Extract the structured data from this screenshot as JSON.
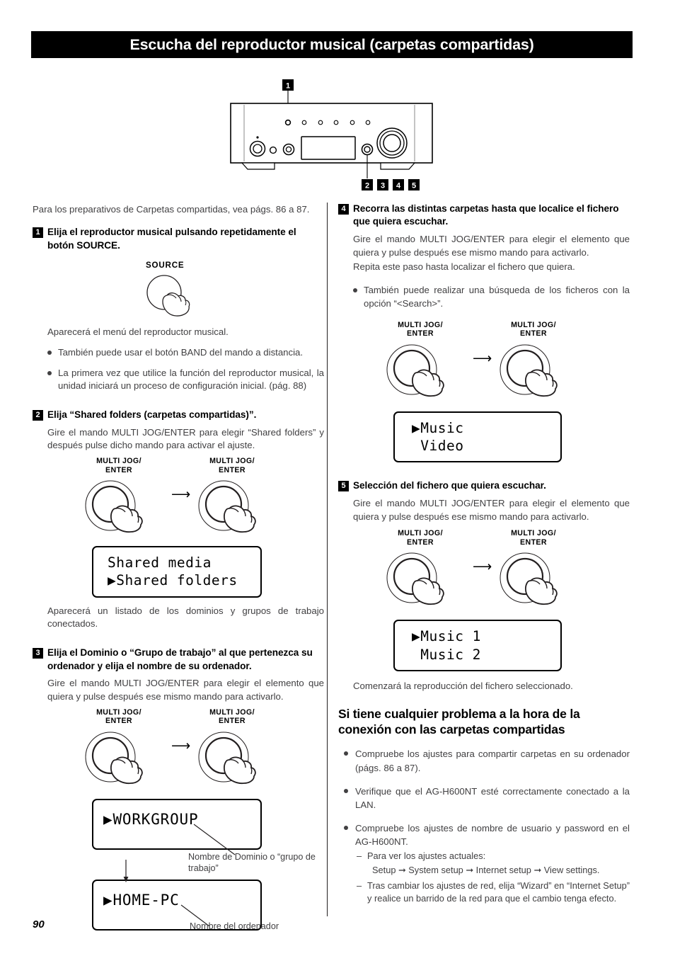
{
  "page": {
    "title": "Escucha del reproductor musical (carpetas compartidas)",
    "number": "90"
  },
  "figure": {
    "callouts": [
      "1",
      "2",
      "3",
      "4",
      "5"
    ]
  },
  "left_column": {
    "lead": "Para los preparativos de Carpetas compartidas, vea págs. 86 a 87.",
    "step1": {
      "num": "1",
      "heading": "Elija el reproductor musical pulsando repetidamente el botón SOURCE.",
      "knob_label": "SOURCE",
      "result": "Aparecerá el menú del reproductor musical.",
      "bullets": [
        "También puede usar el botón BAND del mando a distancia.",
        "La primera vez que utilice la función del reproductor musical, la unidad iniciará un proceso de configuración inicial. (pág. 88)"
      ]
    },
    "step2": {
      "num": "2",
      "heading": "Elija “Shared folders (carpetas compartidas)”.",
      "body": "Gire el mando MULTI JOG/ENTER para elegir “Shared folders” y después pulse dicho mando para activar el ajuste.",
      "knob_label_1": "MULTI JOG/\nENTER",
      "knob_label_2": "MULTI JOG/\nENTER",
      "lcd": {
        "line1": "Shared media",
        "line2": "▶Shared folders"
      },
      "result": "Aparecerá un listado de los dominios y grupos de trabajo conectados."
    },
    "step3": {
      "num": "3",
      "heading": "Elija el Dominio o “Grupo de trabajo” al que pertenezca su ordenador y elija el nombre de su ordenador.",
      "body": "Gire el mando MULTI JOG/ENTER para elegir el elemento que quiera y pulse después ese mismo mando para activarlo.",
      "knob_label_1": "MULTI JOG/\nENTER",
      "knob_label_2": "MULTI JOG/\nENTER",
      "lcd_workgroup": "▶WORKGROUP",
      "lcd_homepc": "▶HOME-PC",
      "callout_domain": "Nombre de Dominio o “grupo de trabajo”",
      "callout_computer": "Nombre del ordenador"
    }
  },
  "right_column": {
    "step4": {
      "num": "4",
      "heading": "Recorra las distintas carpetas hasta que localice el fichero que quiera escuchar.",
      "body_line1": "Gire el mando MULTI JOG/ENTER para elegir el elemento que quiera y pulse después ese mismo mando para activarlo.",
      "body_line2": "Repita este paso hasta localizar el fichero que quiera.",
      "bullet": "También puede realizar una búsqueda de los ficheros con la opción “<Search>”.",
      "knob_label_1": "MULTI JOG/\nENTER",
      "knob_label_2": "MULTI JOG/\nENTER",
      "lcd": {
        "line1": "▶Music",
        "line2": " Video"
      }
    },
    "step5": {
      "num": "5",
      "heading": "Selección del fichero que quiera escuchar.",
      "body": "Gire el mando MULTI JOG/ENTER para elegir el elemento que quiera y pulse después ese mismo mando para activarlo.",
      "knob_label_1": "MULTI JOG/\nENTER",
      "knob_label_2": "MULTI JOG/\nENTER",
      "lcd": {
        "line1": "▶Music 1",
        "line2": " Music 2"
      },
      "result": "Comenzará la reproducción del fichero seleccionado."
    },
    "troubleshooting": {
      "heading": "Si tiene cualquier problema a la hora de la conexión con las carpetas compartidas",
      "bullet1": "Compruebe los ajustes para compartir carpetas en su ordenador (págs. 86 a 87).",
      "bullet2": "Verifique que el AG-H600NT esté correctamente conectado a la LAN.",
      "bullet3": "Compruebe los ajustes de nombre de usuario y password en el AG-H600NT.",
      "sub1": "Para ver los ajustes actuales:",
      "sub1_path": "Setup ➞ System setup ➞ Internet setup ➞ View settings.",
      "sub2": "Tras cambiar los ajustes de red, elija “Wizard” en “Internet Setup” y realice un barrido de la red para que el cambio tenga efecto."
    }
  }
}
